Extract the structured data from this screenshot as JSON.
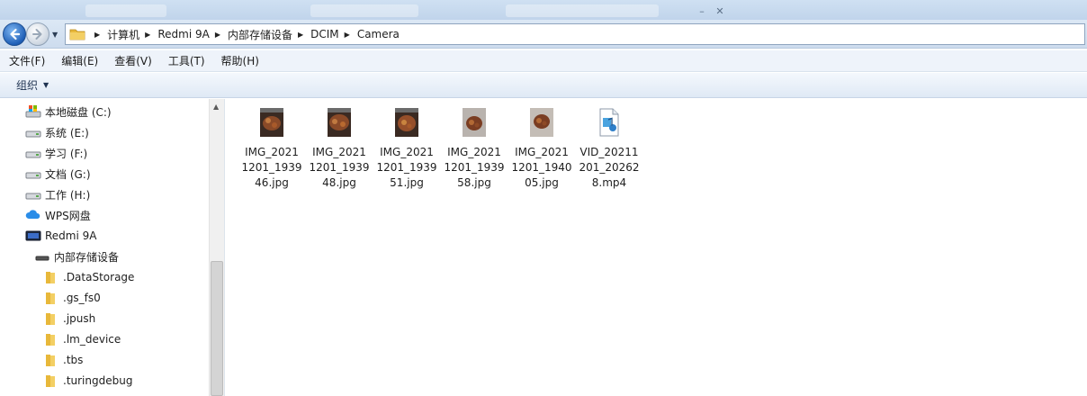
{
  "window": {
    "background_tabs": [
      "",
      "",
      ""
    ]
  },
  "address": {
    "crumbs": [
      "计算机",
      "Redmi 9A",
      "内部存储设备",
      "DCIM",
      "Camera"
    ]
  },
  "menu": {
    "items": [
      "文件(F)",
      "编辑(E)",
      "查看(V)",
      "工具(T)",
      "帮助(H)"
    ]
  },
  "command_bar": {
    "organize": "组织"
  },
  "nav": {
    "items": [
      {
        "label": "本地磁盘 (C:)",
        "icon": "drive-os-icon"
      },
      {
        "label": "系统 (E:)",
        "icon": "drive-icon"
      },
      {
        "label": "学习 (F:)",
        "icon": "drive-icon"
      },
      {
        "label": "文档 (G:)",
        "icon": "drive-icon"
      },
      {
        "label": "工作 (H:)",
        "icon": "drive-icon"
      },
      {
        "label": "WPS网盘",
        "icon": "cloud-icon"
      },
      {
        "label": "Redmi 9A",
        "icon": "phone-icon"
      },
      {
        "label": "内部存储设备",
        "icon": "storage-icon"
      },
      {
        "label": ".DataStorage",
        "icon": "folder-icon"
      },
      {
        "label": ".gs_fs0",
        "icon": "folder-icon"
      },
      {
        "label": ".jpush",
        "icon": "folder-icon"
      },
      {
        "label": ".lm_device",
        "icon": "folder-icon"
      },
      {
        "label": ".tbs",
        "icon": "folder-icon"
      },
      {
        "label": ".turingdebug",
        "icon": "folder-icon"
      }
    ]
  },
  "files": [
    {
      "line1": "IMG_2021",
      "line2": "1201_1939",
      "line3": "46.jpg",
      "type": "image"
    },
    {
      "line1": "IMG_2021",
      "line2": "1201_1939",
      "line3": "48.jpg",
      "type": "image"
    },
    {
      "line1": "IMG_2021",
      "line2": "1201_1939",
      "line3": "51.jpg",
      "type": "image"
    },
    {
      "line1": "IMG_2021",
      "line2": "1201_1939",
      "line3": "58.jpg",
      "type": "image"
    },
    {
      "line1": "IMG_2021",
      "line2": "1201_1940",
      "line3": "05.jpg",
      "type": "image"
    },
    {
      "line1": "VID_20211",
      "line2": "201_20262",
      "line3": "8.mp4",
      "type": "video"
    }
  ],
  "colors": {
    "accent": "#1f5fb7",
    "folder": "#e8b83a",
    "selection_bg": "#dce8f5"
  }
}
